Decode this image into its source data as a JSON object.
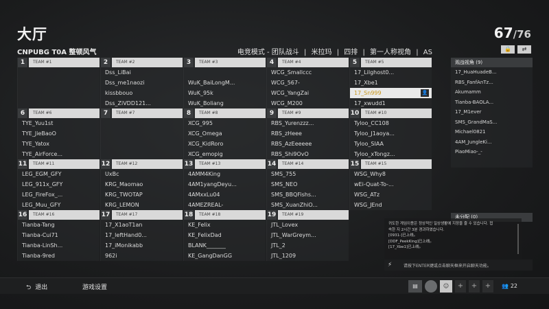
{
  "header": {
    "title": "大厅",
    "player_count": "67",
    "player_total": "/76",
    "room_name": "CNPUBG T0A 整顿风气",
    "mode": "电竞模式 - 团队战斗",
    "map": "米拉玛",
    "squad": "四排",
    "view": "第一人称视角",
    "region": "AS"
  },
  "teams": [
    {
      "num": "1",
      "label": "TEAM #1",
      "players": [
        "",
        "",
        "",
        ""
      ]
    },
    {
      "num": "2",
      "label": "TEAM #2",
      "players": [
        "Dss_LiBai",
        "Dss_me1naozi",
        "kissbbouo",
        "Dss_ZiVDD121..."
      ]
    },
    {
      "num": "3",
      "label": "TEAM #3",
      "players": [
        "",
        "WuK_BaiLongM...",
        "WuK_95k",
        "WuK_Boliang"
      ]
    },
    {
      "num": "4",
      "label": "TEAM #4",
      "players": [
        "WCG_Smallccc",
        "WCG_567-",
        "WCG_YangZai",
        "WCG_M200"
      ]
    },
    {
      "num": "5",
      "label": "TEAM #5",
      "players": [
        "17_Lilghost0...",
        "17_Xbe1",
        "17_Sn999",
        "17_xwudd1"
      ]
    },
    {
      "num": "6",
      "label": "TEAM #6",
      "players": [
        "TYE_Yuu1st",
        "TYE_JieBaoO",
        "TYE_Yatox",
        "TYE_AirForce..."
      ]
    },
    {
      "num": "7",
      "label": "TEAM #7",
      "players": [
        "",
        "",
        "",
        ""
      ]
    },
    {
      "num": "8",
      "label": "TEAM #8",
      "players": [
        "XCG_995",
        "XCG_Omega",
        "XCG_KidRoro",
        "XCG_emopig"
      ]
    },
    {
      "num": "9",
      "label": "TEAM #9",
      "players": [
        "RBS_Yurenzzz...",
        "RBS_zHeee",
        "RBS_AzEeeeee",
        "RBS_Shi9OvO"
      ]
    },
    {
      "num": "10",
      "label": "TEAM #10",
      "players": [
        "Tyloo_CC108",
        "Tyloo_J1aoya...",
        "Tyloo_SIAA",
        "Tyloo_xTongz..."
      ]
    },
    {
      "num": "11",
      "label": "TEAM #11",
      "players": [
        "LEG_EGM_GFY",
        "LEG_911x_GFY",
        "LEG_FireFox_...",
        "LEG_Muu_GFY"
      ]
    },
    {
      "num": "12",
      "label": "TEAM #12",
      "players": [
        "UxBc",
        "KRG_Maomao",
        "KRG_TWOTAP",
        "KRG_LEMON"
      ]
    },
    {
      "num": "13",
      "label": "TEAM #13",
      "players": [
        "4AMM4King",
        "4AM1yangDeyu...",
        "4AMxxLu04",
        "4AMEZREAL-"
      ]
    },
    {
      "num": "14",
      "label": "TEAM #14",
      "players": [
        "SMS_755",
        "SMS_NEO",
        "SMS_BBQFishs...",
        "SMS_XuanZhiO..."
      ]
    },
    {
      "num": "15",
      "label": "TEAM #15",
      "players": [
        "WSG_Why8",
        "wEi-Quat-To-...",
        "WSG_ATz",
        "WSG_JEnd"
      ]
    },
    {
      "num": "16",
      "label": "TEAM #16",
      "players": [
        "Tianba-Tang",
        "Tianba-Cui71",
        "Tianba-LinSh...",
        "Tianba-9red"
      ]
    },
    {
      "num": "17",
      "label": "TEAM #17",
      "players": [
        "17_X1aoT1an",
        "17_leftHand0...",
        "17_iMonikabb",
        "962i"
      ]
    },
    {
      "num": "18",
      "label": "TEAM #18",
      "players": [
        "KE_Felix",
        "KE_FelixDad",
        "BLANK_______",
        "KE_GangDanGG"
      ]
    },
    {
      "num": "19",
      "label": "TEAM #19",
      "players": [
        "JTL_Lovex",
        "JTL_WarGreym...",
        "JTL_2",
        "JTL_1209"
      ]
    }
  ],
  "spectators": {
    "header": "观战视角 (9)",
    "items": [
      "17_HuaHuadeB...",
      "RBS_FanfAnTz...",
      "Akumamm",
      "Tianba-BAOLA...",
      "17_M1ever",
      "SMS_GrandMaS...",
      "Michael0821",
      "4AM_JungleKi...",
      "PiaoMiao-_-"
    ]
  },
  "unassigned": "未分配 (0)",
  "chat": {
    "lines": [
      "귀도한 게임이용은 정상적인 일상생활에 지장을 줄 수 있습니다. 접",
      "속한 지 2시간 3분 경과하였습니다.",
      "[0931-]已上线。",
      "[DDF_PeekKing]已上线。",
      "[17_Xbe1]已上线。"
    ],
    "placeholder": "请按下ENTER键或点击聊天框来开启聊天功能。"
  },
  "bottom": {
    "exit": "退出",
    "settings": "游戏设置",
    "friends_count": "22"
  }
}
